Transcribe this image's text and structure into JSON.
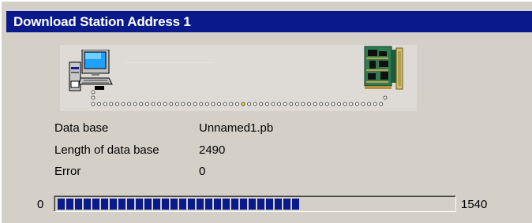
{
  "window": {
    "title": "Download Station Address 1"
  },
  "animation": {
    "pc_icon": "computer-icon",
    "board_icon": "circuit-board-icon",
    "dot_color": "#ffffff",
    "active_dot_color": "#f5e000"
  },
  "info": {
    "database_label": "Data base",
    "database_value": "Unnamed1.pb",
    "length_label": "Length of data base",
    "length_value": "2490",
    "error_label": "Error",
    "error_value": "0"
  },
  "progress": {
    "min_label": "0",
    "max_label": "1540",
    "fraction": 0.625,
    "color": "#0a1a8c"
  }
}
